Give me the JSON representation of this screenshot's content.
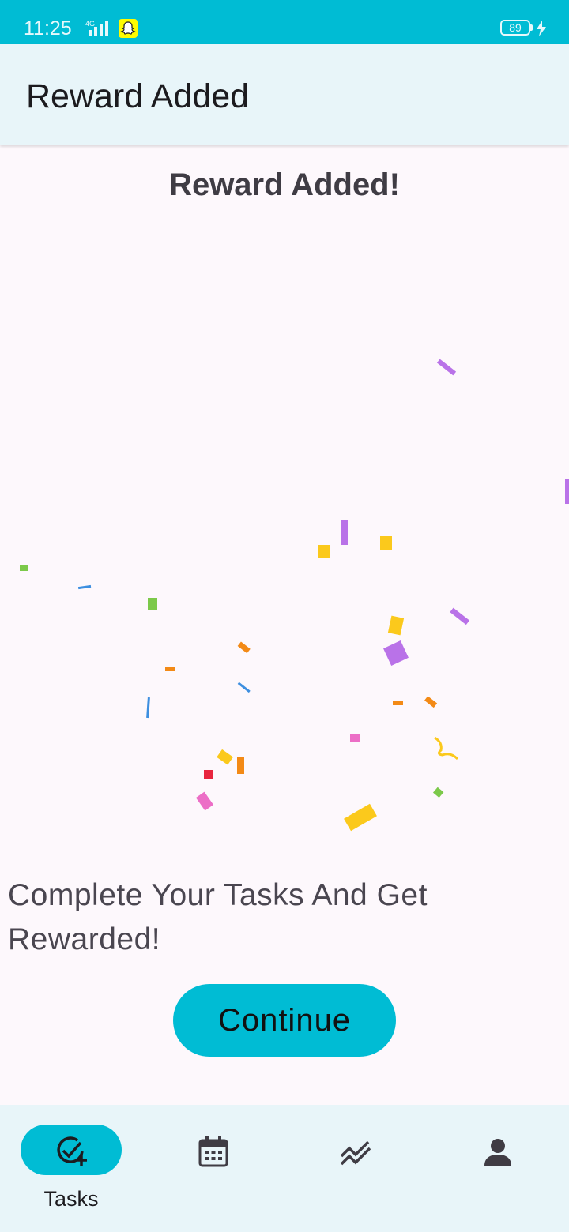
{
  "status_bar": {
    "time": "11:25",
    "network": "4G",
    "battery": "89"
  },
  "app_bar": {
    "title": "Reward Added"
  },
  "main": {
    "heading": "Reward Added!",
    "tagline": "Complete Your Tasks And Get Rewarded!",
    "continue_label": "Continue"
  },
  "bottom_nav": {
    "items": [
      {
        "label": "Tasks",
        "icon": "task-add-icon",
        "selected": true
      },
      {
        "label": "",
        "icon": "calendar-icon",
        "selected": false
      },
      {
        "label": "",
        "icon": "stats-icon",
        "selected": false
      },
      {
        "label": "",
        "icon": "person-icon",
        "selected": false
      }
    ]
  },
  "colors": {
    "accent": "#00bcd4",
    "surface": "#e8f5f9",
    "background": "#fdf8fc"
  }
}
